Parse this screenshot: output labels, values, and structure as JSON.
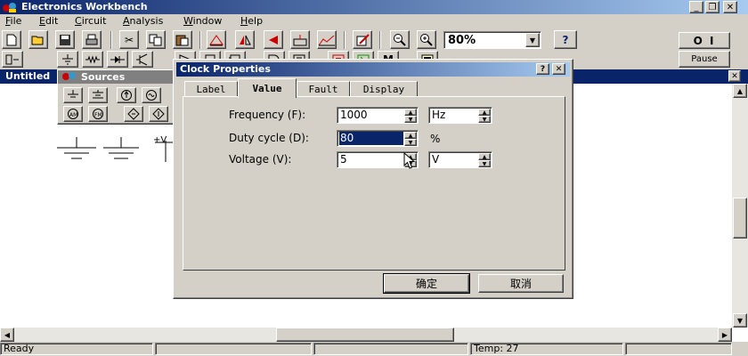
{
  "app": {
    "title": "Electronics Workbench",
    "caption_minimize": "_",
    "caption_restore": "❐",
    "caption_close": "✕"
  },
  "menu": [
    {
      "label": "File",
      "key": "F",
      "rest": "ile"
    },
    {
      "label": "Edit",
      "key": "E",
      "rest": "dit"
    },
    {
      "label": "Circuit",
      "key": "C",
      "rest": "ircuit"
    },
    {
      "label": "Analysis",
      "key": "A",
      "rest": "nalysis"
    },
    {
      "label": "Window",
      "key": "W",
      "rest": "indow"
    },
    {
      "label": "Help",
      "key": "H",
      "rest": "elp"
    }
  ],
  "toolbar": {
    "zoom_value": "80%",
    "help_label": "?",
    "power_label": "O  I",
    "pause_label": "Pause"
  },
  "document": {
    "title": "Untitled",
    "close_label": "✕"
  },
  "palette": {
    "title": "Sources",
    "vcc_label": "+V"
  },
  "dialog": {
    "title": "Clock Properties",
    "help_label": "?",
    "close_label": "✕",
    "tabs": [
      "Label",
      "Value",
      "Fault",
      "Display"
    ],
    "active_tab": "Value",
    "fields": {
      "frequency": {
        "label": "Frequency (F):",
        "value": "1000",
        "unit": "Hz"
      },
      "duty_cycle": {
        "label": "Duty cycle (D):",
        "value": "80",
        "unit": "%"
      },
      "voltage": {
        "label": "Voltage (V):",
        "value": "5",
        "unit": "V"
      }
    },
    "ok_label": "确定",
    "cancel_label": "取消"
  },
  "status": {
    "left": "Ready",
    "temp": "Temp:  27"
  },
  "colors": {
    "title_active": "#0a246a",
    "face": "#d4d0c8",
    "selection": "#0a246a"
  }
}
